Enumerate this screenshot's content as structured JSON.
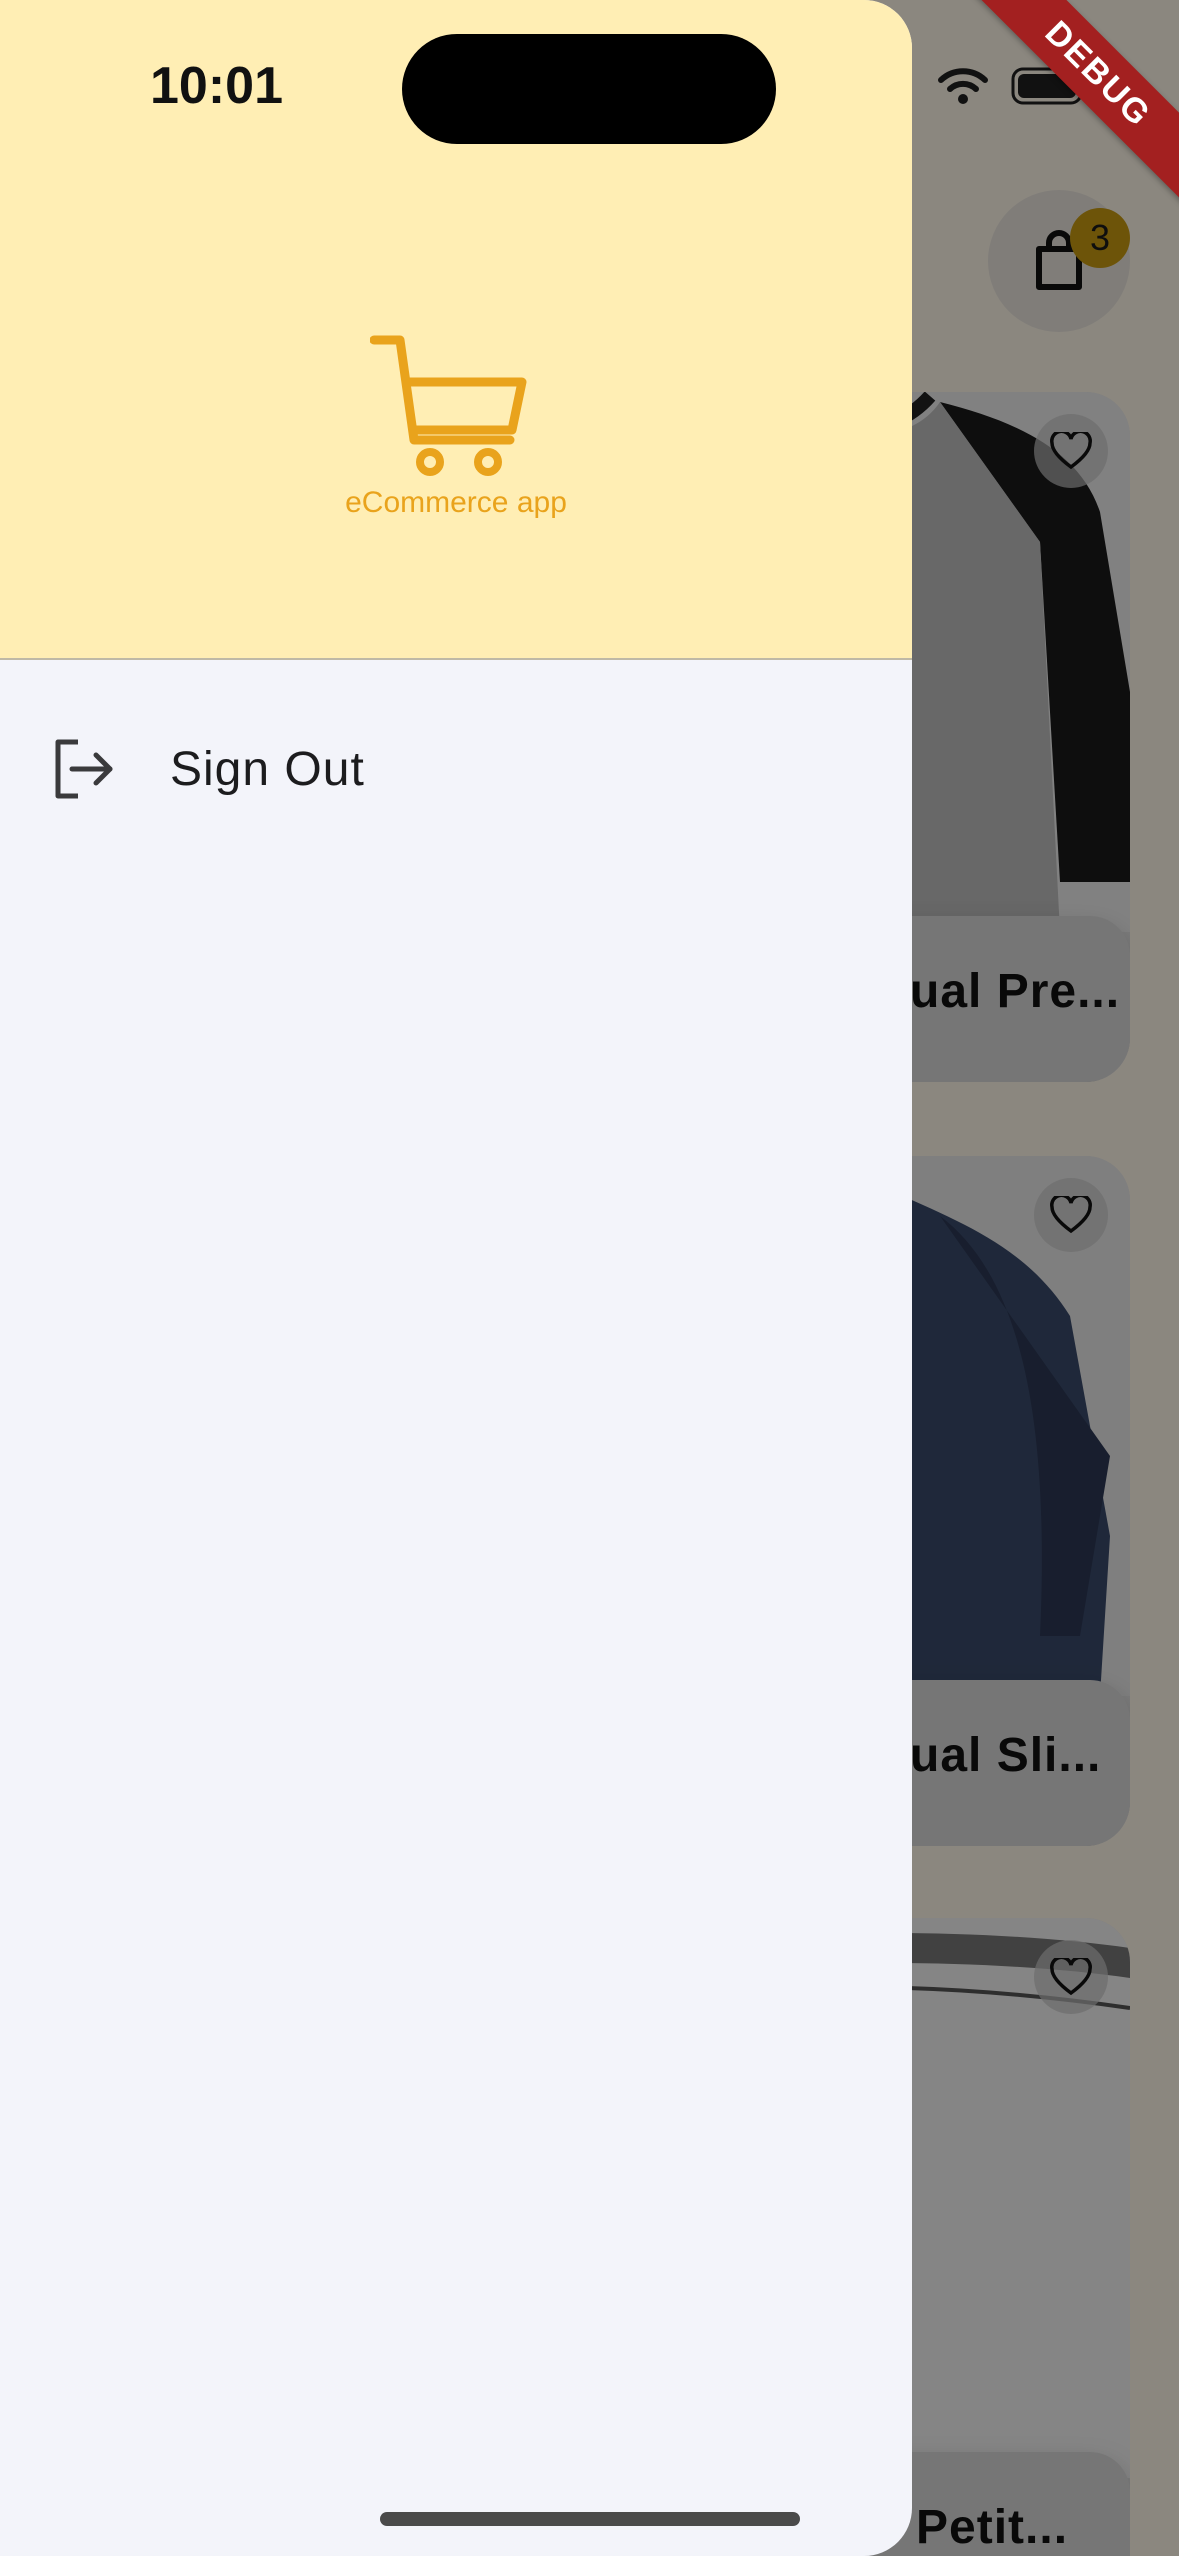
{
  "status_bar": {
    "time": "10:01"
  },
  "debug_banner": {
    "label": "DEBUG"
  },
  "drawer": {
    "brand_text": "eCommerce app",
    "menu": [
      {
        "label": "Sign Out",
        "icon": "sign-out-icon"
      }
    ],
    "accent_color": "#e9a31c",
    "header_color": "#ffeeb4"
  },
  "background": {
    "cart_badge_count": "3",
    "products": [
      {
        "title_visible": "ual Pre..."
      },
      {
        "title_visible": "ual Sli..."
      },
      {
        "title_visible": "Petit..."
      }
    ]
  }
}
